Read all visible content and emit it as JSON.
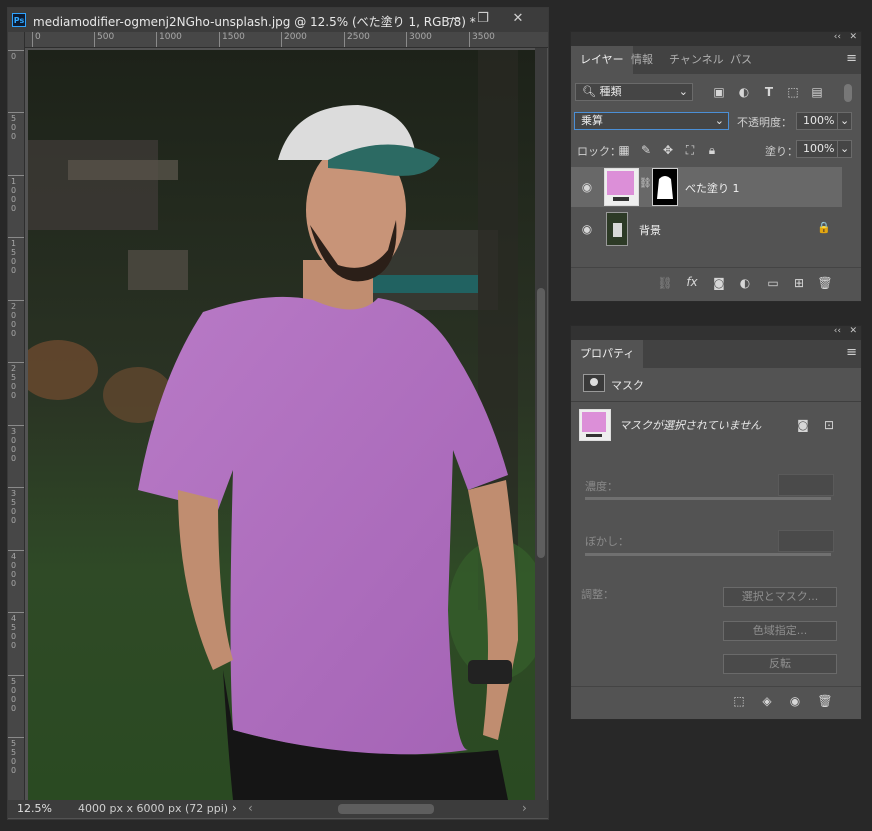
{
  "doc": {
    "app_badge": "Ps",
    "title": "mediamodifier-ogmenj2NGho-unsplash.jpg @ 12.5% (べた塗り 1, RGB/8) *",
    "minimize": "—",
    "restore": "❐",
    "close": "✕",
    "ruler_h": [
      "0",
      "500",
      "1000",
      "1500",
      "2000",
      "2500",
      "3000",
      "3500"
    ],
    "ruler_v": [
      "0",
      "500",
      "1000",
      "1500",
      "2000",
      "2500",
      "3000",
      "3500",
      "4000",
      "4500",
      "5000",
      "5500"
    ],
    "zoom": "12.5%",
    "size": "4000 px x 6000 px (72 ppi)",
    "nav_arrow": "›",
    "scroll_left": "‹",
    "scroll_right": "›",
    "shirt_color": "#b46fc2"
  },
  "layers": {
    "collapse": "‹‹",
    "close": "✕",
    "menu": "≡",
    "tabs": [
      "レイヤー",
      "情報",
      "チャンネル",
      "パス"
    ],
    "filter_label": "種類",
    "blend_mode": "乗算",
    "opacity_label": "不透明度：",
    "opacity_value": "100%",
    "lock_label": "ロック：",
    "fill_label": "塗り：",
    "fill_value": "100%",
    "items": [
      {
        "name": "べた塗り 1",
        "swatch": "#dc8fd8"
      },
      {
        "name": "背景",
        "lock": "🔒"
      }
    ],
    "fill_swatch_color": "#dc8fd8"
  },
  "properties": {
    "collapse": "‹‹",
    "close": "✕",
    "menu": "≡",
    "tab": "プロパティ",
    "section": "マスク",
    "mask_status": "マスクが選択されていません",
    "density_label": "濃度：",
    "feather_label": "ぼかし：",
    "adjust_label": "調整：",
    "btn_select_mask": "選択とマスク...",
    "btn_color_range": "色域指定...",
    "btn_invert": "反転"
  }
}
